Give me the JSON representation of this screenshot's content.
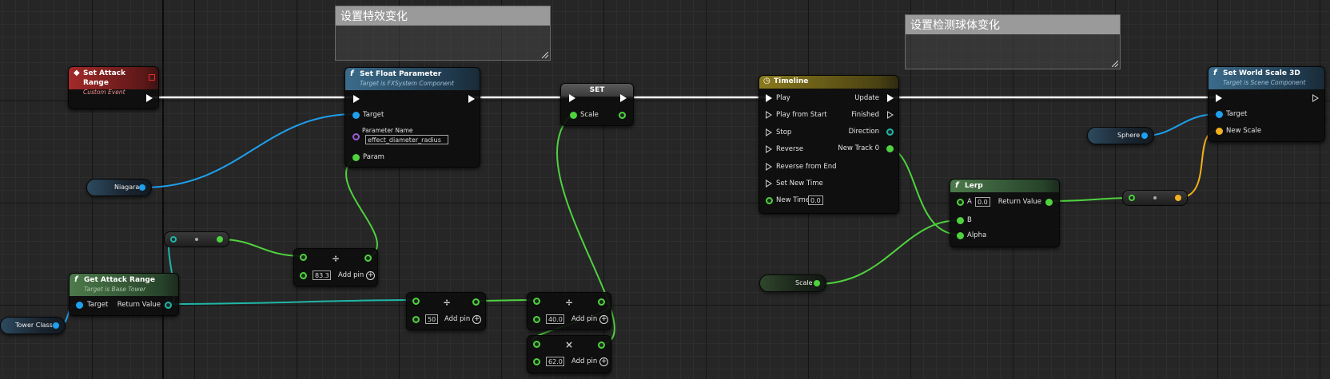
{
  "comments": {
    "fx": "设置特效变化",
    "sphere": "设置检测球体变化"
  },
  "nodes": {
    "set_attack_range": {
      "title": "Set Attack Range",
      "subtitle": "Custom Event"
    },
    "set_float_parameter": {
      "icon": "f",
      "title": "Set Float Parameter",
      "subtitle": "Target is FXSystem Component",
      "target": "Target",
      "param_name_label": "Parameter Name",
      "param_name_value": "effect_diameter_radius",
      "param": "Param"
    },
    "set_scale": {
      "title": "SET",
      "scale": "Scale"
    },
    "timeline": {
      "title": "Timeline",
      "play": "Play",
      "play_from_start": "Play from Start",
      "stop": "Stop",
      "reverse": "Reverse",
      "reverse_from_end": "Reverse from End",
      "set_new_time": "Set New Time",
      "new_time": "New Time",
      "new_time_value": "0.0",
      "update": "Update",
      "finished": "Finished",
      "direction": "Direction",
      "new_track": "New Track 0"
    },
    "lerp": {
      "icon": "f",
      "title": "Lerp",
      "a": "A",
      "a_value": "0.0",
      "b": "B",
      "alpha": "Alpha",
      "return_value": "Return Value"
    },
    "set_world_scale": {
      "icon": "f",
      "title": "Set World Scale 3D",
      "subtitle": "Target is Scene Component",
      "target": "Target",
      "new_scale": "New Scale"
    },
    "get_attack_range": {
      "icon": "f",
      "title": "Get Attack Range",
      "subtitle": "Target is Base Tower",
      "target": "Target",
      "return_value": "Return Value"
    },
    "divide_1": {
      "op": "÷",
      "value": "83.3",
      "add_pin": "Add pin"
    },
    "divide_2": {
      "op": "÷",
      "value": "50",
      "add_pin": "Add pin"
    },
    "divide_3": {
      "op": "÷",
      "value": "40.0",
      "add_pin": "Add pin"
    },
    "multiply": {
      "op": "×",
      "value": "62.0",
      "add_pin": "Add pin"
    }
  },
  "variables": {
    "niagara": "Niagara",
    "tower_class": "Tower Class",
    "sphere": "Sphere",
    "scale": "Scale"
  },
  "colors": {
    "exec": "#ffffff",
    "object_pin": "#1ea0ee",
    "float_pin": "#4fd23e",
    "name_pin": "#9a5ad6",
    "vector_pin": "#f0b020"
  }
}
